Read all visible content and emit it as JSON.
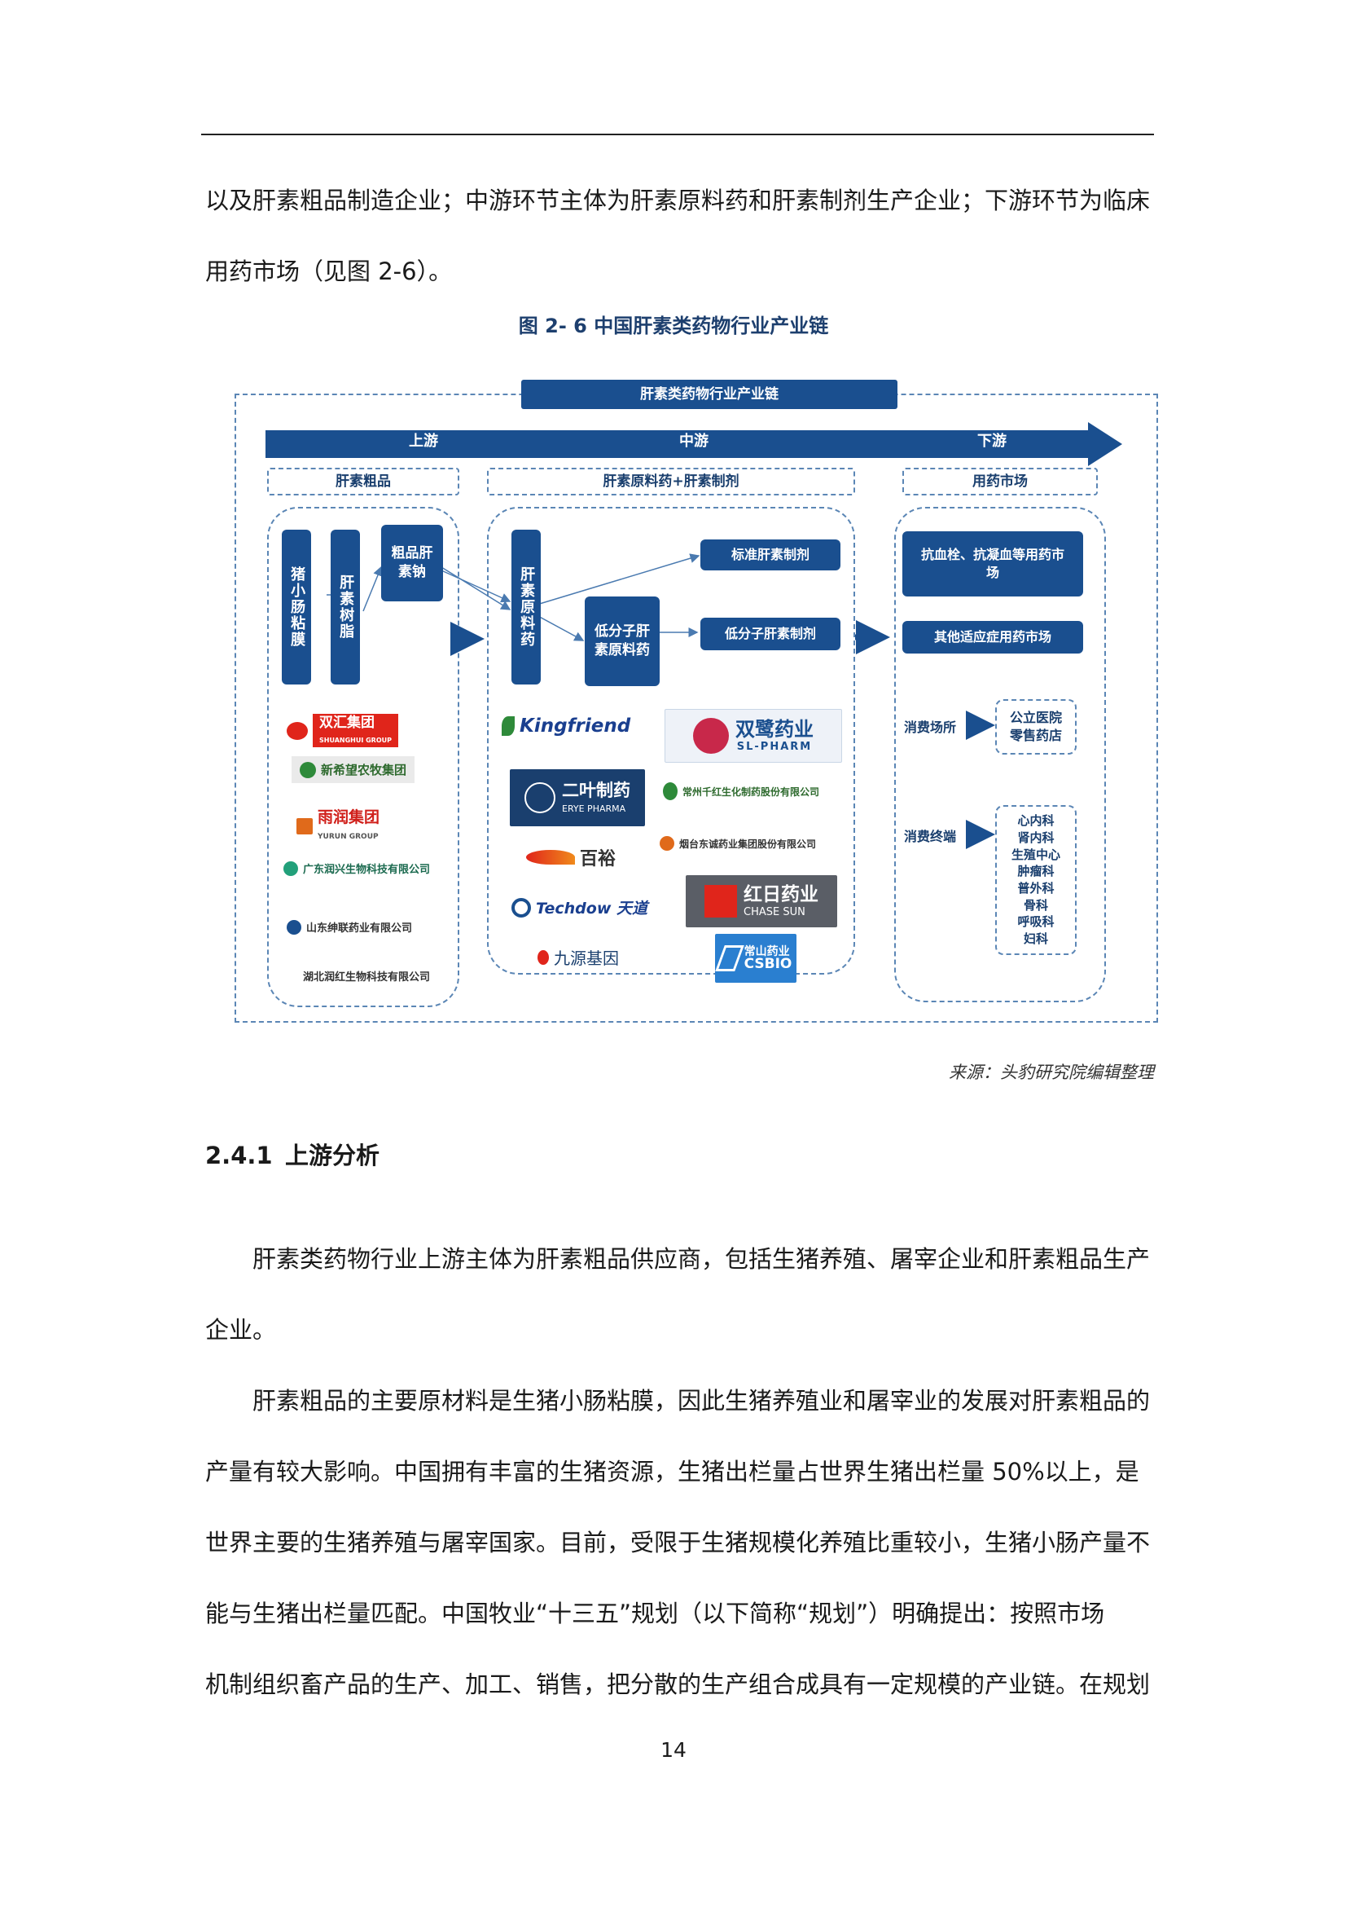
{
  "page": {
    "intro_line1": "以及肝素粗品制造企业；中游环节主体为肝素原料药和肝素制剂生产企业；下游环节为临床",
    "intro_line2": "用药市场（见图 2-6）。",
    "figure_title": "图 2- 6 中国肝素类药物行业产业链",
    "source": "来源：头豹研究院编辑整理",
    "section_num": "2.4.1",
    "section_title": "上游分析",
    "para1_line1": "肝素类药物行业上游主体为肝素粗品供应商，包括生猪养殖、屠宰企业和肝素粗品生产",
    "para1_line2": "企业。",
    "para2": [
      "肝素粗品的主要原材料是生猪小肠粘膜，因此生猪养殖业和屠宰业的发展对肝素粗品的",
      "产量有较大影响。中国拥有丰富的生猪资源，生猪出栏量占世界生猪出栏量 50%以上，是",
      "世界主要的生猪养殖与屠宰国家。目前，受限于生猪规模化养殖比重较小，生猪小肠产量不",
      "能与生猪出栏量匹配。中国牧业“十三五”规划（以下简称“规划”）明确提出：按照市场",
      "机制组织畜产品的生产、加工、销售，把分散的生产组合成具有一定规模的产业链。在规划"
    ],
    "page_number": "14"
  },
  "diagram": {
    "title": "肝素类药物行业产业链",
    "stages": [
      "上游",
      "中游",
      "下游"
    ],
    "col_heads": [
      "肝素粗品",
      "肝素原料药+肝素制剂",
      "用药市场"
    ],
    "upstream": {
      "box1": "猪小肠粘膜",
      "box2": "肝素树脂",
      "box3": "粗品肝素钠",
      "logos": [
        "双汇集团",
        "新希望农牧集团",
        "雨润集团",
        "广东润兴生物科技有限公司",
        "山东绅联药业有限公司",
        "湖北润红生物科技有限公司"
      ],
      "logo_sub": [
        "SHUANGHUI GROUP",
        "YURUN GROUP"
      ]
    },
    "midstream": {
      "api": "肝素原料药",
      "lmw_api": "低分子肝素原料药",
      "std_prep": "标准肝素制剂",
      "lmw_prep": "低分子肝素制剂",
      "logos": [
        "Kingfriend",
        "双鹭药业",
        "SL-PHARM",
        "二叶制药",
        "ERYE PHARMA",
        "常州千红生化制药股份有限公司",
        "百裕",
        "烟台东诚药业集团股份有限公司",
        "Techdow 天道",
        "红日药业",
        "CHASE SUN",
        "九源基因",
        "常山药业",
        "CSBIO"
      ]
    },
    "downstream": {
      "market1": "抗血栓、抗凝血等用药市场",
      "market2": "其他适应症用药市场",
      "place_label": "消费场所",
      "places": "公立医院 零售药店",
      "terminal_label": "消费终端",
      "terminals": [
        "心内科",
        "肾内科",
        "生殖中心",
        "肿瘤科",
        "普外科",
        "骨科",
        "呼吸科",
        "妇科"
      ]
    },
    "colors": {
      "primary": "#1a4f8f",
      "dash": "#5b86b5"
    }
  }
}
